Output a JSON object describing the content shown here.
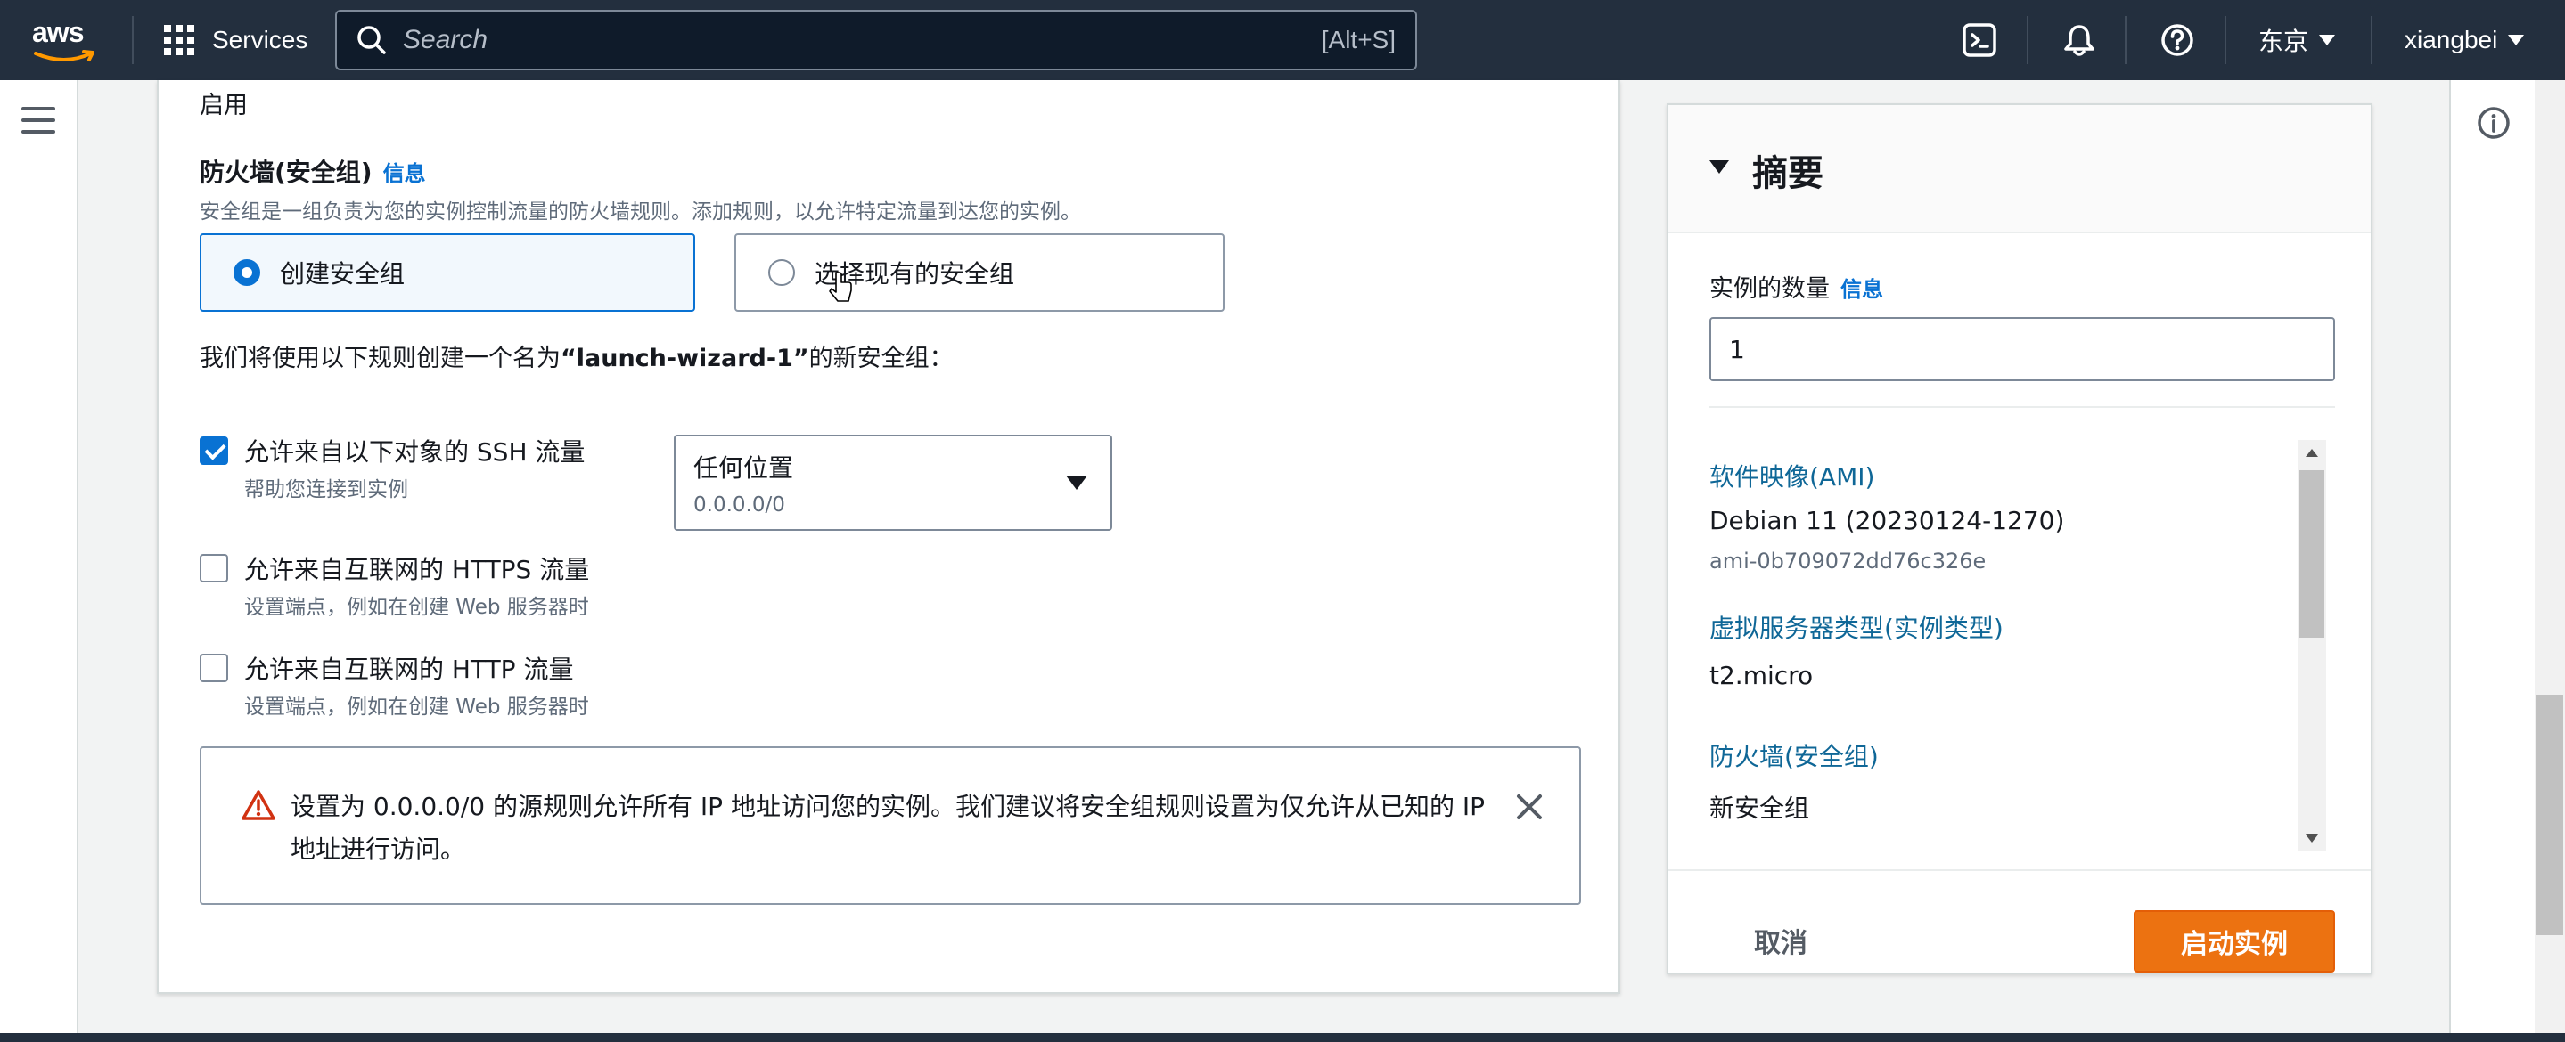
{
  "topnav": {
    "logo": "aws",
    "services_label": "Services",
    "search_placeholder": "Search",
    "search_shortcut": "[Alt+S]",
    "region": "东京",
    "user": "xiangbei",
    "icons": [
      "cloudshell-icon",
      "bell-icon",
      "help-icon"
    ]
  },
  "main": {
    "enabled_text": "启用",
    "firewall_title": "防火墙(安全组)",
    "info_link": "信息",
    "firewall_desc": "安全组是一组负责为您的实例控制流量的防火墙规则。添加规则，以允许特定流量到达您的实例。",
    "options": [
      {
        "label": "创建安全组",
        "selected": true
      },
      {
        "label": "选择现有的安全组",
        "selected": false
      }
    ],
    "rule_intro_prefix": "我们将使用以下规则创建一个名为",
    "rule_intro_name": "“launch-wizard-1”",
    "rule_intro_suffix": "的新安全组：",
    "rules": [
      {
        "label": "允许来自以下对象的 SSH 流量",
        "desc": "帮助您连接到实例",
        "checked": true
      },
      {
        "label": "允许来自互联网的 HTTPS 流量",
        "desc": "设置端点，例如在创建 Web 服务器时",
        "checked": false
      },
      {
        "label": "允许来自互联网的 HTTP 流量",
        "desc": "设置端点，例如在创建 Web 服务器时",
        "checked": false
      }
    ],
    "ssh_source": {
      "value": "任何位置",
      "cidr": "0.0.0.0/0"
    },
    "warning_text": "设置为 0.0.0.0/0 的源规则允许所有 IP 地址访问您的实例。我们建议将安全组规则设置为仅允许从已知的 IP 地址进行访问。"
  },
  "summary": {
    "title": "摘要",
    "instance_count_label": "实例的数量",
    "info_link": "信息",
    "instance_count": "1",
    "ami_label": "软件映像(AMI)",
    "ami_name": "Debian 11 (20230124-1270)",
    "ami_id": "ami-0b709072dd76c326e",
    "instance_type_label": "虚拟服务器类型(实例类型)",
    "instance_type": "t2.micro",
    "firewall_label": "防火墙(安全组)",
    "firewall_value": "新安全组",
    "cancel_label": "取消",
    "launch_label": "启动实例"
  },
  "colors": {
    "nav_bg": "#232f3e",
    "primary_blue": "#0972d3",
    "launch_orange": "#ec7211",
    "warning_red": "#d13212"
  }
}
